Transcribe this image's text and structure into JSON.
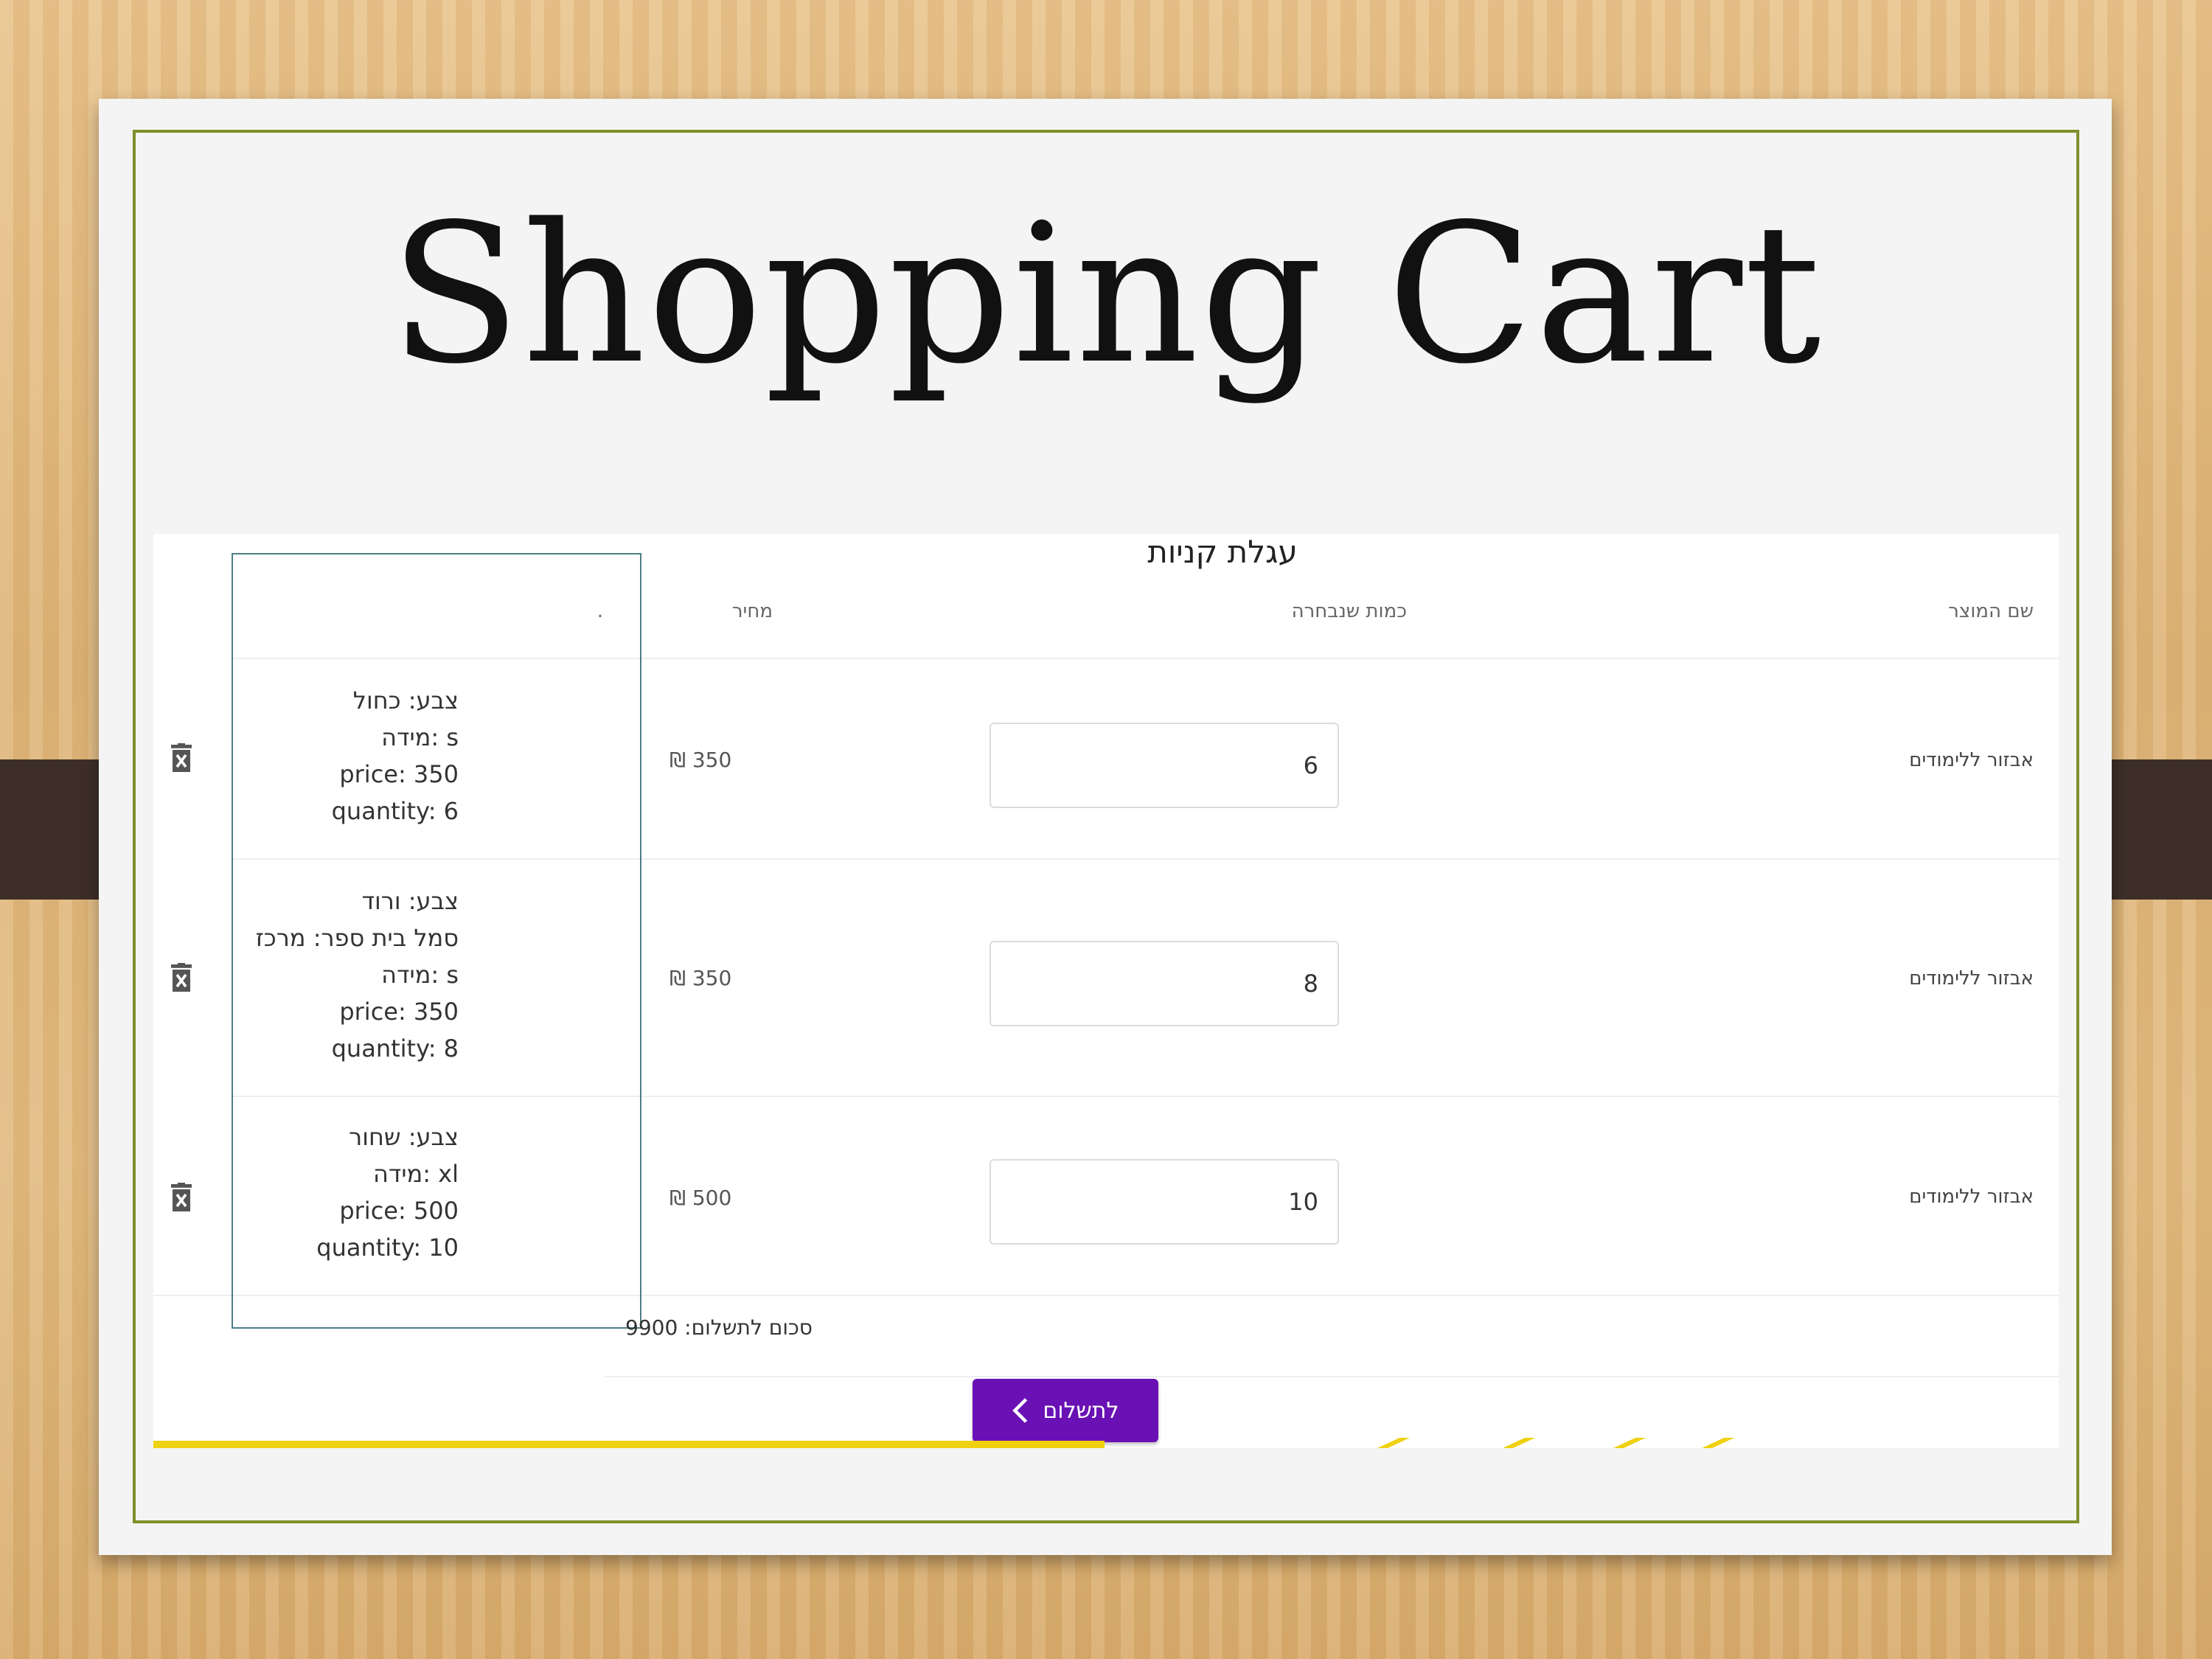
{
  "slide": {
    "title": "Shopping Cart"
  },
  "cart": {
    "title": "עגלת קניות",
    "headers": {
      "product_name": "שם המוצר",
      "quantity": "כמות שנבחרה",
      "price": "מחיר",
      "details": "."
    },
    "rows": [
      {
        "product": "אבזור ללימודים",
        "quantity": "6",
        "price": "350 ₪",
        "details": [
          "צבע: כחול",
          "מידה: s",
          "price: 350",
          "quantity: 6"
        ]
      },
      {
        "product": "אבזור ללימודים",
        "quantity": "8",
        "price": "350 ₪",
        "details": [
          "צבע: ורוד",
          "סמל בית ספר: מרכז",
          "מידה: s",
          "price: 350",
          "quantity: 8"
        ]
      },
      {
        "product": "אבזור ללימודים",
        "quantity": "10",
        "price": "500 ₪",
        "details": [
          "צבע: שחור",
          "מידה: xl",
          "price: 500",
          "quantity: 10"
        ]
      }
    ],
    "total_label": "סכום לתשלום: 9900",
    "pay_button_label": "לתשלום",
    "icons": {
      "delete": "trash-icon",
      "pay_arrow": "chevron-left-icon"
    },
    "colors": {
      "pay_button": "#6a11b5",
      "slide_border": "#7f8f2a",
      "details_box": "#4f7d86",
      "accent_strip": "#f0d10f"
    }
  }
}
